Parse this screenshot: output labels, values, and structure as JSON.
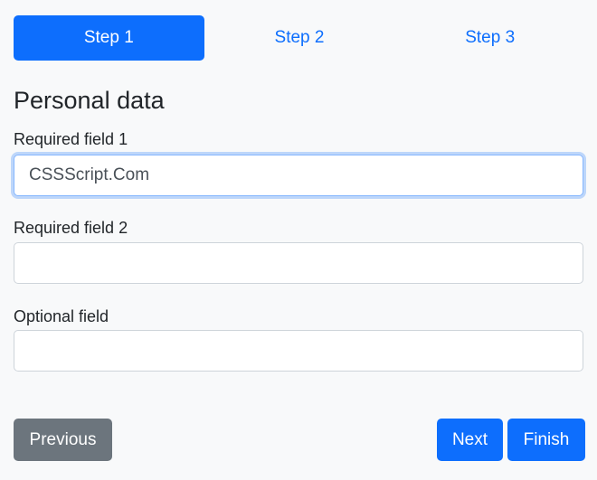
{
  "steps": [
    "Step 1",
    "Step 2",
    "Step 3"
  ],
  "section_title": "Personal data",
  "fields": [
    {
      "label": "Required field 1",
      "value": "CSSScript.Com"
    },
    {
      "label": "Required field 2",
      "value": ""
    },
    {
      "label": "Optional field",
      "value": ""
    }
  ],
  "buttons": {
    "previous": "Previous",
    "next": "Next",
    "finish": "Finish"
  },
  "colors": {
    "primary": "#0d6efd",
    "secondary": "#6c757d"
  }
}
